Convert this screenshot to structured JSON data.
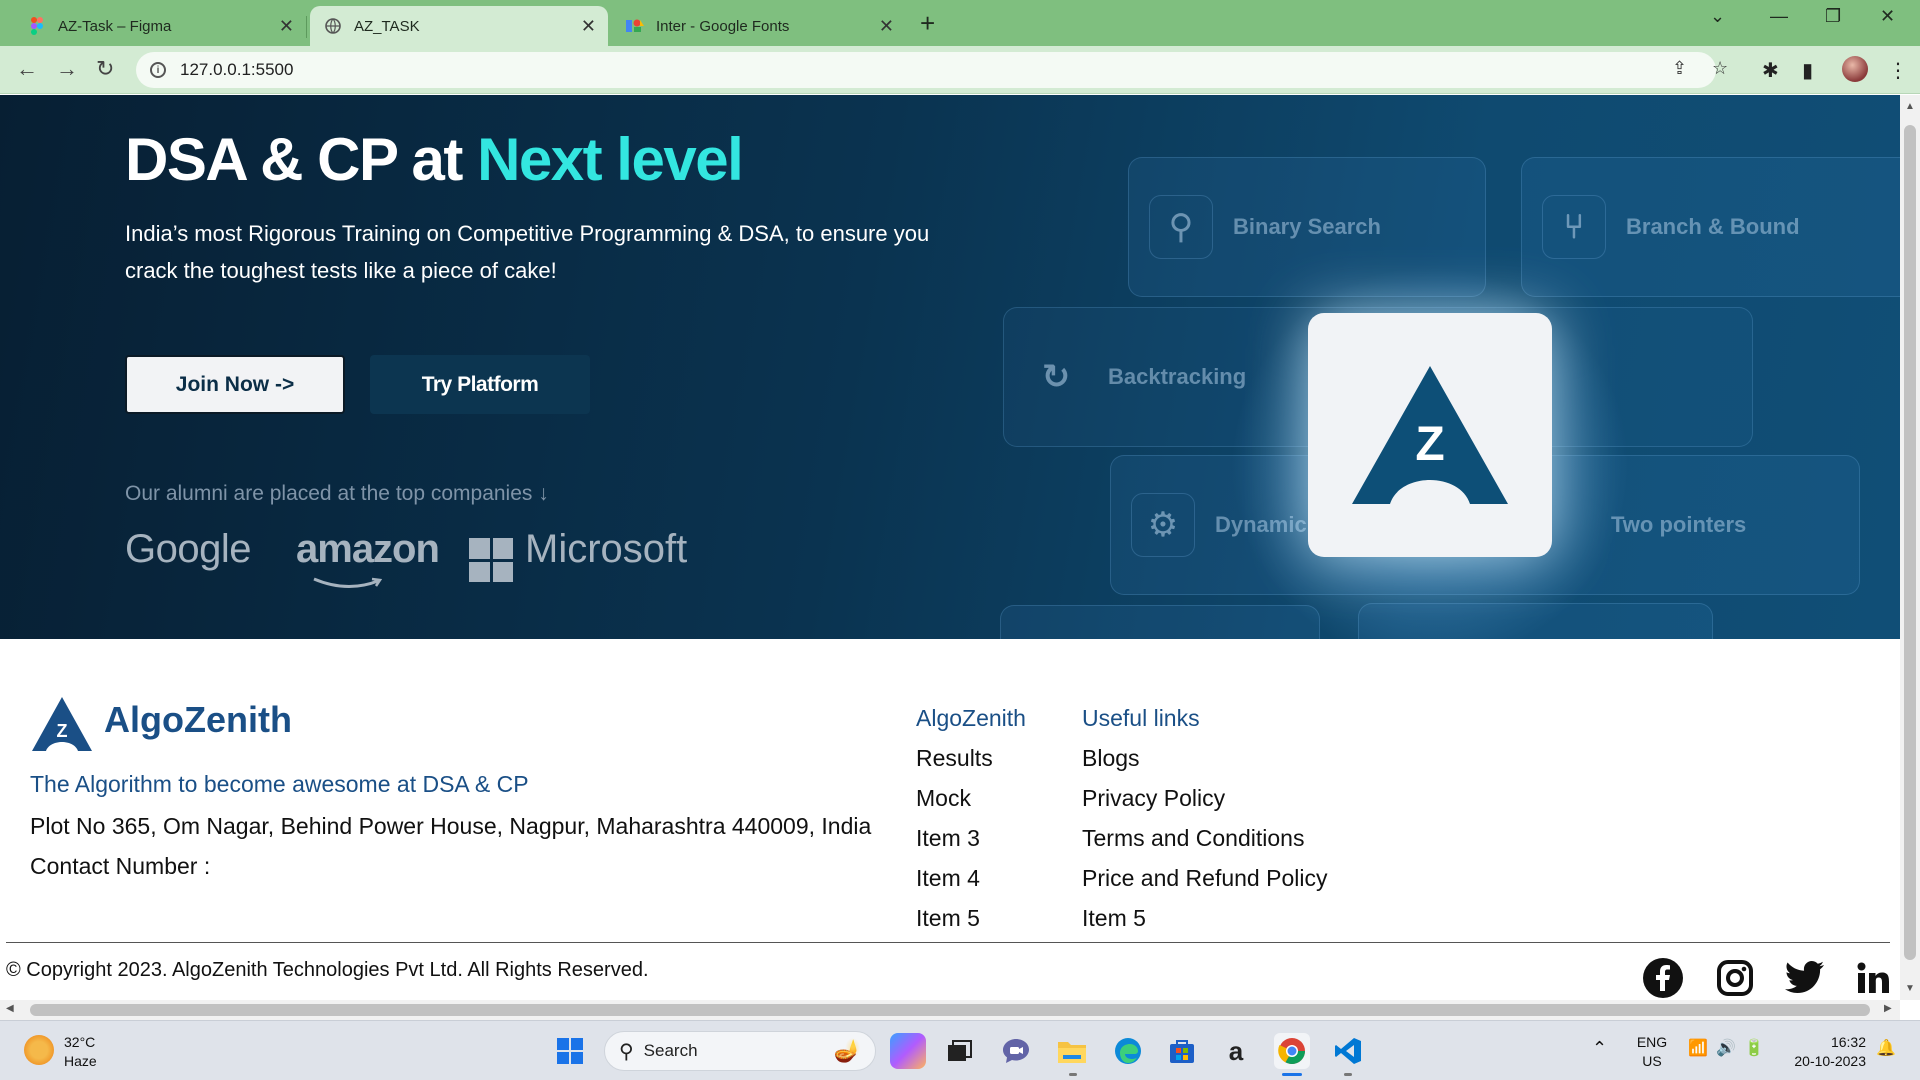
{
  "browser": {
    "tabs": [
      {
        "title": "AZ-Task – Figma",
        "active": false
      },
      {
        "title": "AZ_TASK",
        "active": true
      },
      {
        "title": "Inter - Google Fonts",
        "active": false
      }
    ],
    "url": "127.0.0.1:5500"
  },
  "hero": {
    "title_main": "DSA & CP at ",
    "title_accent": "Next level",
    "subtitle": "India’s most Rigorous Training on Competitive Programming & DSA, to ensure you crack the toughest tests like a piece of cake!",
    "join_label": "Join Now ->",
    "try_label": "Try Platform",
    "alumni_text": "Our alumni are placed at the top companies ↓",
    "companies": [
      "Google",
      "amazon",
      "Microsoft"
    ],
    "cards": [
      "Binary Search",
      "Branch & Bound",
      "Backtracking",
      "Dynamic",
      "Two pointers"
    ],
    "accent_color": "#33e6e0"
  },
  "footer": {
    "brand": "AlgoZenith",
    "tagline": "The Algorithm to become awesome at DSA & CP",
    "address": "Plot No 365, Om Nagar, Behind Power House, Nagpur, Maharashtra 440009, India",
    "contact": "Contact Number :",
    "col1": {
      "head": "AlgoZenith",
      "items": [
        "Results",
        "Mock",
        "Item 3",
        "Item 4",
        "Item 5"
      ]
    },
    "col2": {
      "head": "Useful links",
      "items": [
        "Blogs",
        "Privacy Policy",
        "Terms and Conditions",
        "Price and Refund Policy",
        "Item 5"
      ]
    },
    "copyright": "© Copyright 2023. AlgoZenith Technologies Pvt Ltd. All Rights Reserved.",
    "brand_color": "#1a4f86"
  },
  "taskbar": {
    "temp": "32°C",
    "weather": "Haze",
    "search": "Search",
    "lang": "ENG",
    "region": "US",
    "time": "16:32",
    "date": "20-10-2023"
  }
}
